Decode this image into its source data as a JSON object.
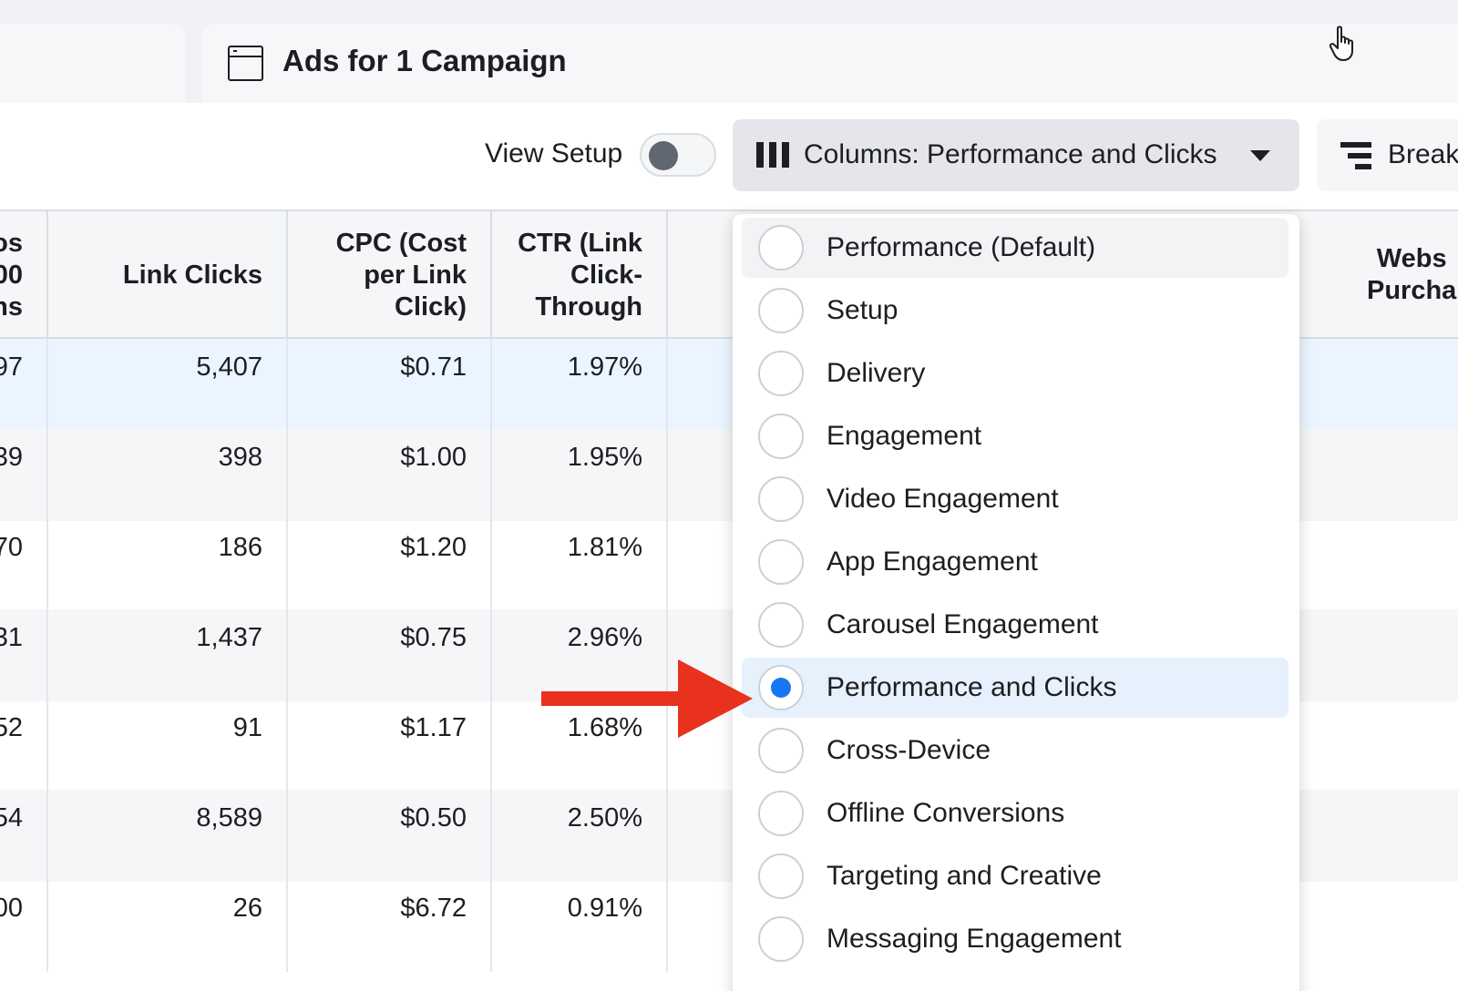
{
  "tab": {
    "title": "Ads for 1 Campaign"
  },
  "toolbar": {
    "view_setup_label": "View Setup",
    "columns_label": "Columns: Performance and Clicks",
    "breakdown_label": "Break"
  },
  "table": {
    "headers": {
      "clipped": [
        "os",
        "00",
        "ns"
      ],
      "link_clicks": [
        "Link Clicks"
      ],
      "cpc": [
        "CPC (Cost",
        "per Link",
        "Click)"
      ],
      "ctr": [
        "CTR (Link",
        "Click-",
        "Through"
      ],
      "website": [
        "Webs",
        "Purcha"
      ]
    },
    "rows": [
      {
        "clipped": "97",
        "link_clicks": "5,407",
        "cpc": "$0.71",
        "ctr": "1.97%"
      },
      {
        "clipped": "39",
        "link_clicks": "398",
        "cpc": "$1.00",
        "ctr": "1.95%"
      },
      {
        "clipped": "70",
        "link_clicks": "186",
        "cpc": "$1.20",
        "ctr": "1.81%"
      },
      {
        "clipped": "31",
        "link_clicks": "1,437",
        "cpc": "$0.75",
        "ctr": "2.96%"
      },
      {
        "clipped": "52",
        "link_clicks": "91",
        "cpc": "$1.17",
        "ctr": "1.68%"
      },
      {
        "clipped": "54",
        "link_clicks": "8,589",
        "cpc": "$0.50",
        "ctr": "2.50%"
      },
      {
        "clipped": "00",
        "link_clicks": "26",
        "cpc": "$6.72",
        "ctr": "0.91%"
      }
    ]
  },
  "dropdown": {
    "options": [
      {
        "label": "Performance (Default)"
      },
      {
        "label": "Setup"
      },
      {
        "label": "Delivery"
      },
      {
        "label": "Engagement"
      },
      {
        "label": "Video Engagement"
      },
      {
        "label": "App Engagement"
      },
      {
        "label": "Carousel Engagement"
      },
      {
        "label": "Performance and Clicks"
      },
      {
        "label": "Cross-Device"
      },
      {
        "label": "Offline Conversions"
      },
      {
        "label": "Targeting and Creative"
      },
      {
        "label": "Messaging Engagement"
      }
    ],
    "selected_index": 7,
    "hovered_index": 0
  },
  "colors": {
    "accent": "#1877f2",
    "annotation_arrow": "#e8321e"
  },
  "icons": {
    "tab": "window-icon",
    "columns": "columns-icon",
    "caret": "caret-down-icon",
    "breakdown": "breakdown-icon",
    "cursor": "hand-pointer-icon",
    "arrow": "arrow-right-icon"
  }
}
